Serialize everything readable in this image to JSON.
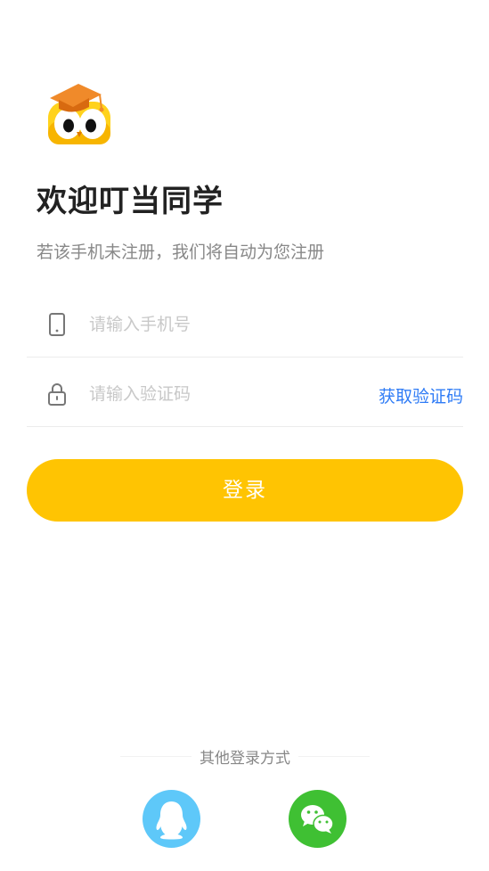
{
  "header": {
    "logo_icon": "owl-graduation-cap-logo",
    "title": "欢迎叮当同学",
    "subtitle": "若该手机未注册，我们将自动为您注册"
  },
  "form": {
    "phone": {
      "icon": "phone-icon",
      "placeholder": "请输入手机号",
      "value": ""
    },
    "code": {
      "icon": "lock-icon",
      "placeholder": "请输入验证码",
      "value": "",
      "get_code_label": "获取验证码"
    },
    "login_label": "登录"
  },
  "other_login": {
    "label": "其他登录方式",
    "providers": [
      {
        "name": "qq",
        "icon": "qq-penguin-icon",
        "color": "#5ec8f9"
      },
      {
        "name": "wechat",
        "icon": "wechat-icon",
        "color": "#3fc033"
      }
    ]
  },
  "colors": {
    "accent": "#ffc402",
    "link": "#2f7cf6"
  }
}
